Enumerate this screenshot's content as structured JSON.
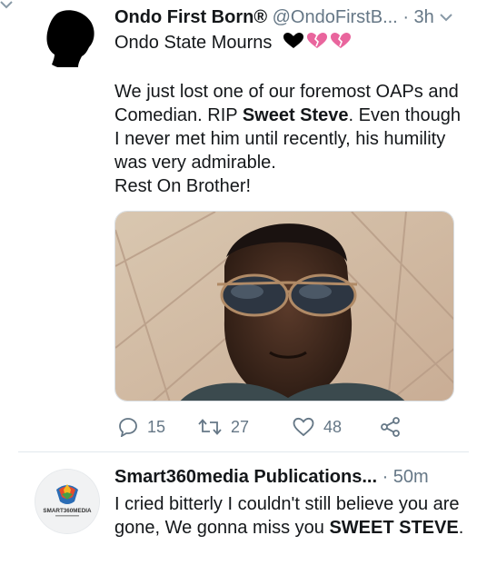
{
  "tweets": [
    {
      "name": "Ondo First Born®",
      "handle": "@OndoFirstB...",
      "separator": "·",
      "time": "3h",
      "subline": "Ondo State Mourns",
      "body_prefix": "We just lost one of our foremost OAPs and Comedian. RIP ",
      "body_bold": "Sweet Steve",
      "body_suffix": ". Even though I never met him until recently, his humility was very admirable.",
      "body_line2": "Rest On Brother!",
      "stats": {
        "replies": "15",
        "retweets": "27",
        "likes": "48"
      }
    },
    {
      "name": "Smart360media Publications...",
      "separator": "·",
      "time": "50m",
      "body_prefix": "I cried bitterly I couldn't still believe you are gone, We gonna miss you ",
      "body_bold": "SWEET STEVE",
      "body_suffix": ".",
      "avatar_logo_text": "SMART360MEDIA"
    }
  ],
  "icons": [
    "black-heart-icon",
    "broken-heart-icon",
    "reply-icon",
    "retweet-icon",
    "like-icon",
    "share-icon",
    "chevron-down-icon"
  ],
  "colors": {
    "secondary_text": "#657786",
    "primary_text": "#14171a",
    "broken_heart": "#e9659d",
    "divider": "#e1e8ed"
  }
}
